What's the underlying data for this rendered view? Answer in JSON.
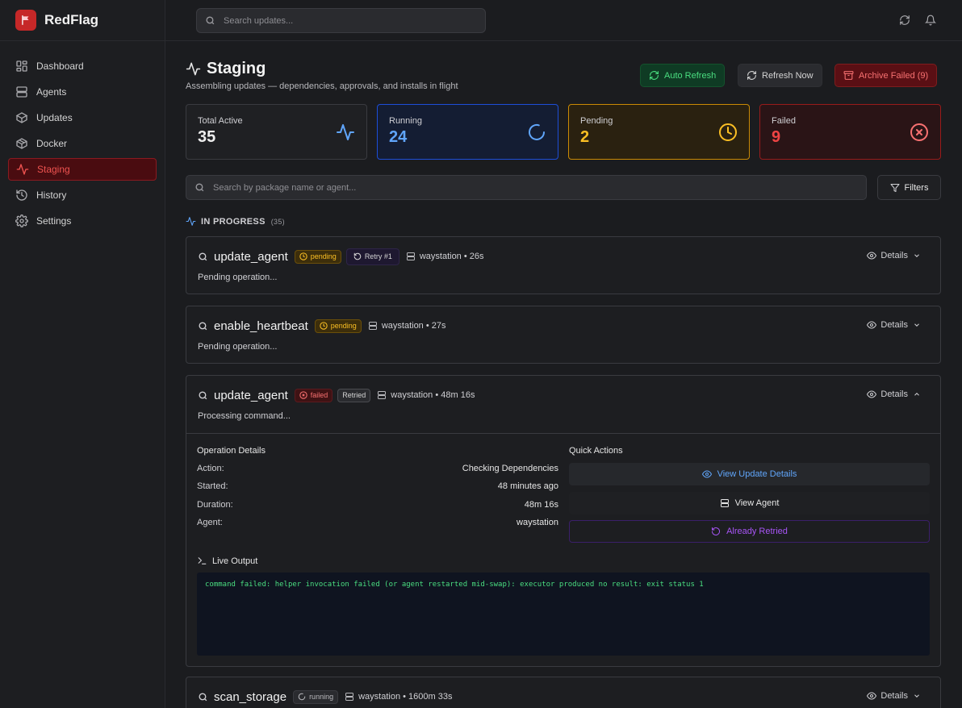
{
  "app": {
    "name": "RedFlag"
  },
  "sidebar": {
    "items": [
      {
        "label": "Dashboard",
        "icon": "dashboard-icon",
        "active": false
      },
      {
        "label": "Agents",
        "icon": "server-icon",
        "active": false
      },
      {
        "label": "Updates",
        "icon": "package-icon",
        "active": false
      },
      {
        "label": "Docker",
        "icon": "box-icon",
        "active": false
      },
      {
        "label": "Staging",
        "icon": "activity-icon",
        "active": true
      },
      {
        "label": "History",
        "icon": "history-icon",
        "active": false
      },
      {
        "label": "Settings",
        "icon": "gear-icon",
        "active": false
      }
    ]
  },
  "topbar": {
    "search_placeholder": "Search updates..."
  },
  "page": {
    "title": "Staging",
    "subtitle": "Assembling updates — dependencies, approvals, and installs in flight",
    "buttons": {
      "auto_refresh": "Auto Refresh",
      "refresh_now": "Refresh Now",
      "archive_failed": "Archive Failed (9)"
    }
  },
  "stats": {
    "total": {
      "label": "Total Active",
      "value": "35"
    },
    "running": {
      "label": "Running",
      "value": "24"
    },
    "pending": {
      "label": "Pending",
      "value": "2"
    },
    "failed": {
      "label": "Failed",
      "value": "9"
    }
  },
  "filter_bar": {
    "placeholder": "Search by package name or agent...",
    "filters_label": "Filters"
  },
  "section": {
    "title": "IN PROGRESS",
    "count": "(35)"
  },
  "operations": [
    {
      "name": "update_agent",
      "status": "pending",
      "retry": "Retry #1",
      "agent": "waystation",
      "age": "26s",
      "message": "Pending operation...",
      "details": "Details"
    },
    {
      "name": "enable_heartbeat",
      "status": "pending",
      "agent": "waystation",
      "age": "27s",
      "message": "Pending operation...",
      "details": "Details"
    },
    {
      "name": "update_agent",
      "status": "failed",
      "retried": "Retried",
      "agent": "waystation",
      "age": "48m 16s",
      "message": "Processing command...",
      "details": "Details"
    },
    {
      "name": "scan_storage",
      "status": "running",
      "agent": "waystation",
      "age": "1600m 33s",
      "details": "Details"
    }
  ],
  "expanded": {
    "operation_details_title": "Operation Details",
    "rows": [
      {
        "label": "Action:",
        "value": "Checking Dependencies"
      },
      {
        "label": "Started:",
        "value": "48 minutes ago"
      },
      {
        "label": "Duration:",
        "value": "48m 16s"
      },
      {
        "label": "Agent:",
        "value": "waystation"
      }
    ],
    "quick_actions_title": "Quick Actions",
    "actions": {
      "view_update": "View Update Details",
      "view_agent": "View Agent",
      "already_retried": "Already Retried"
    },
    "live_output_title": "Live Output",
    "live_output": "command failed: helper invocation failed (or agent restarted mid-swap): executor produced no result: exit status 1"
  },
  "colors": {
    "brand": "#c62828",
    "running": "#60a5fa",
    "pending": "#fbbf24",
    "failed": "#ef4444",
    "success": "#4ade80",
    "retried": "#a855f7"
  }
}
